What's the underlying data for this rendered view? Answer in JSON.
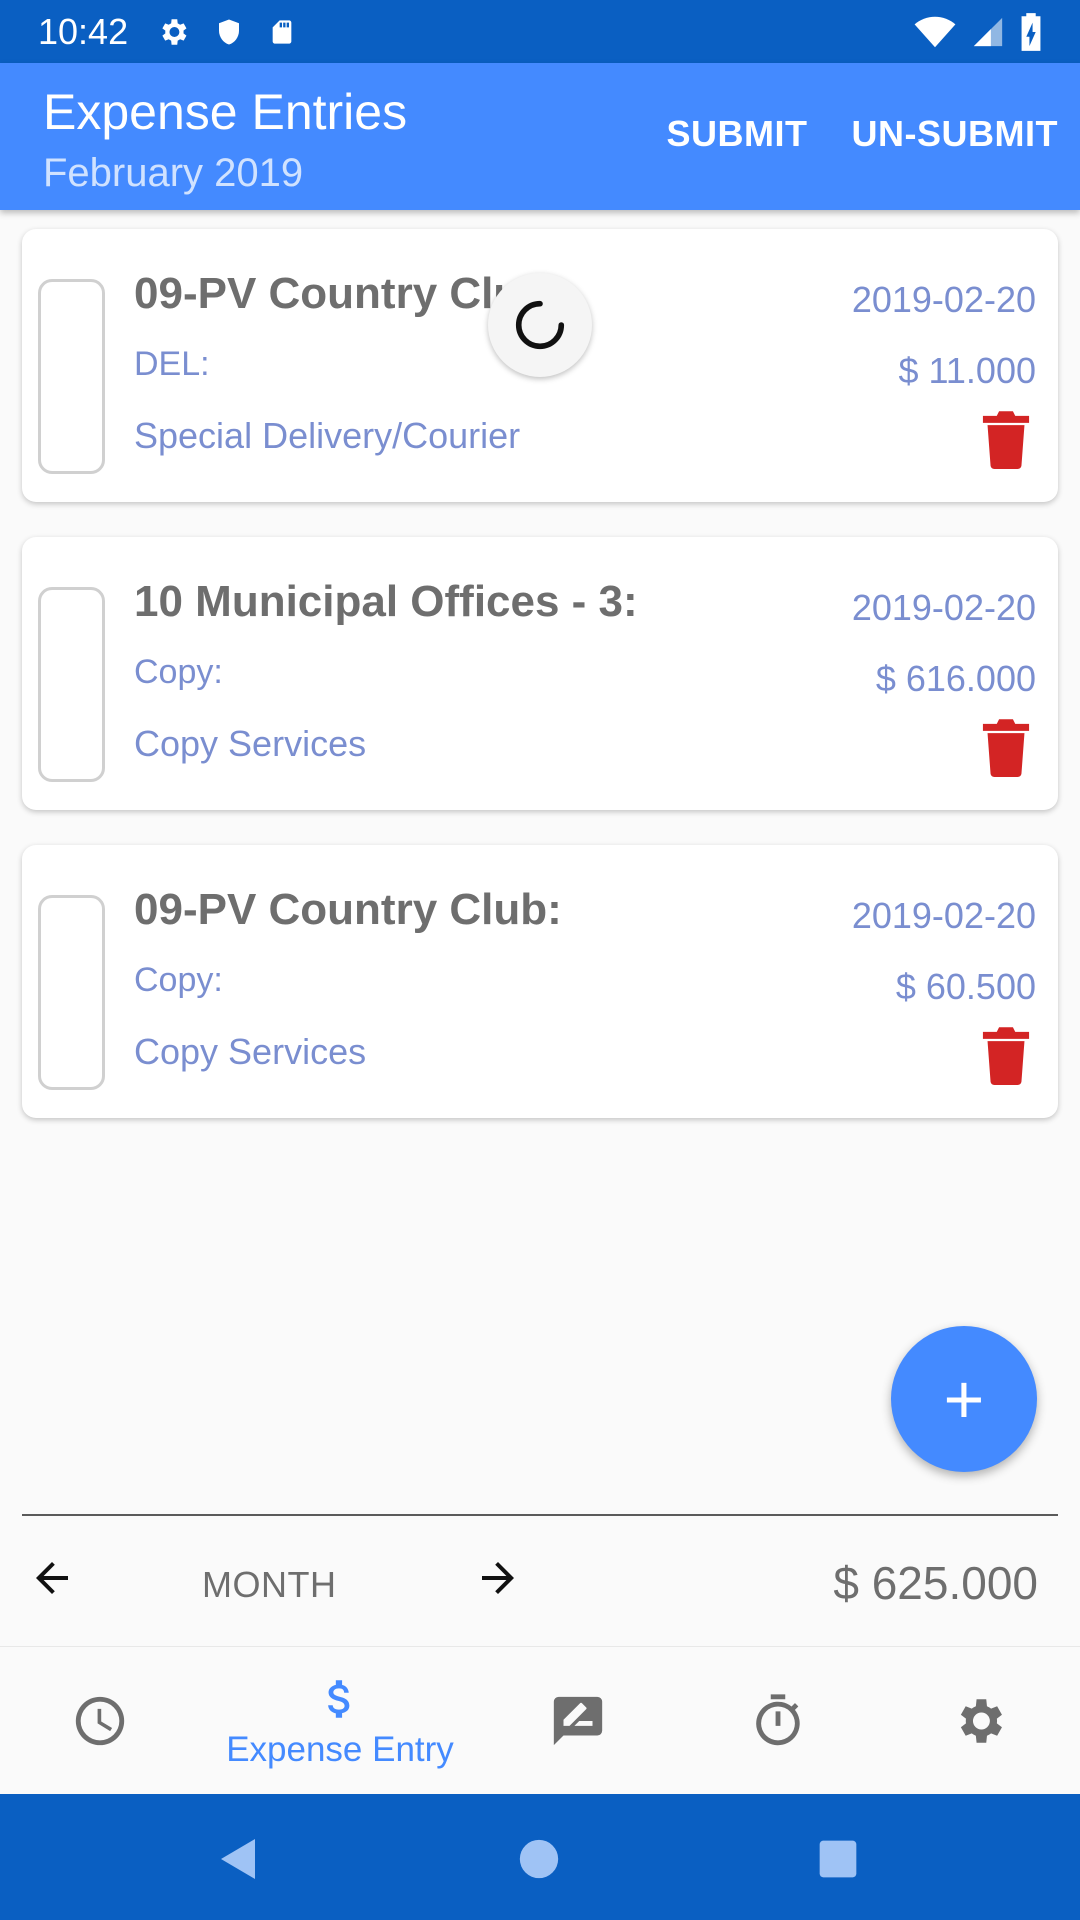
{
  "status_bar": {
    "time": "10:42"
  },
  "app_bar": {
    "title": "Expense Entries",
    "subtitle": "February 2019",
    "actions": {
      "submit": "SUBMIT",
      "unsubmit": "UN-SUBMIT"
    }
  },
  "entries": [
    {
      "title": "09-PV Country Club:",
      "code": "DEL:",
      "description": "Special Delivery/Courier",
      "date": "2019-02-20",
      "amount": "$ 11.000"
    },
    {
      "title": "10 Municipal Offices - 3:",
      "code": "Copy:",
      "description": "Copy Services",
      "date": "2019-02-20",
      "amount": "$ 616.000"
    },
    {
      "title": "09-PV Country Club:",
      "code": "Copy:",
      "description": "Copy Services",
      "date": "2019-02-20",
      "amount": "$ 60.500"
    }
  ],
  "fab": {
    "label": "+"
  },
  "summary": {
    "period": "MONTH",
    "total": "$ 625.000"
  },
  "bottom_nav": {
    "active_label": "Expense Entry",
    "items": [
      "clock-icon",
      "dollar-icon",
      "feedback-icon",
      "timer-icon",
      "gear-icon"
    ]
  },
  "colors": {
    "accent": "#448aff",
    "status_bar": "#0a5fc2",
    "delete": "#d32424",
    "muted_blue": "#7a8ed0"
  }
}
